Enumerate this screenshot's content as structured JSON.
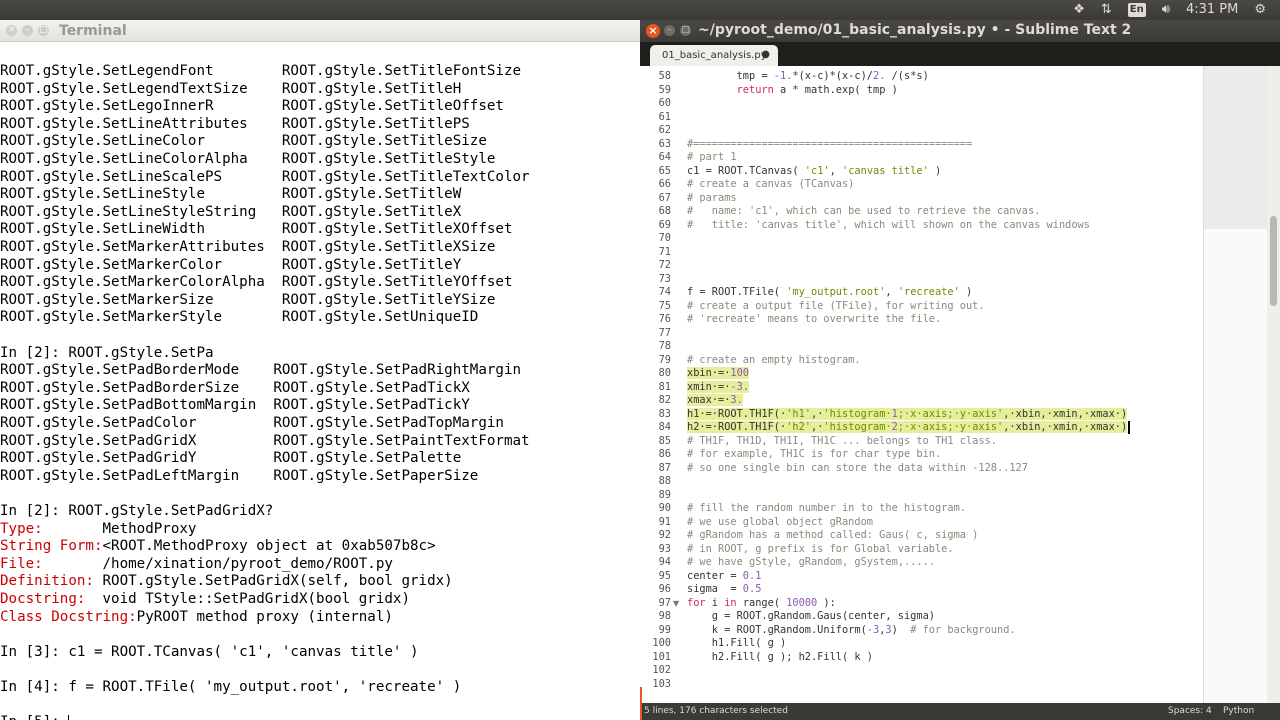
{
  "topbar": {
    "clock": "4:31 PM",
    "keyboard": "En",
    "icons": [
      "dropbox-icon",
      "network-icon",
      "keyboard-icon",
      "volume-icon",
      "clock",
      "gear-icon"
    ]
  },
  "terminal": {
    "title": "Terminal",
    "lines": [
      {
        "t": "ROOT.gStyle.SetLegendFont        ROOT.gStyle.SetTitleFontSize",
        "c": ""
      },
      {
        "t": "ROOT.gStyle.SetLegendTextSize    ROOT.gStyle.SetTitleH",
        "c": ""
      },
      {
        "t": "ROOT.gStyle.SetLegoInnerR        ROOT.gStyle.SetTitleOffset",
        "c": ""
      },
      {
        "t": "ROOT.gStyle.SetLineAttributes    ROOT.gStyle.SetTitlePS",
        "c": ""
      },
      {
        "t": "ROOT.gStyle.SetLineColor         ROOT.gStyle.SetTitleSize",
        "c": ""
      },
      {
        "t": "ROOT.gStyle.SetLineColorAlpha    ROOT.gStyle.SetTitleStyle",
        "c": ""
      },
      {
        "t": "ROOT.gStyle.SetLineScalePS       ROOT.gStyle.SetTitleTextColor",
        "c": ""
      },
      {
        "t": "ROOT.gStyle.SetLineStyle         ROOT.gStyle.SetTitleW",
        "c": ""
      },
      {
        "t": "ROOT.gStyle.SetLineStyleString   ROOT.gStyle.SetTitleX",
        "c": ""
      },
      {
        "t": "ROOT.gStyle.SetLineWidth         ROOT.gStyle.SetTitleXOffset",
        "c": ""
      },
      {
        "t": "ROOT.gStyle.SetMarkerAttributes  ROOT.gStyle.SetTitleXSize",
        "c": ""
      },
      {
        "t": "ROOT.gStyle.SetMarkerColor       ROOT.gStyle.SetTitleY",
        "c": ""
      },
      {
        "t": "ROOT.gStyle.SetMarkerColorAlpha  ROOT.gStyle.SetTitleYOffset",
        "c": ""
      },
      {
        "t": "ROOT.gStyle.SetMarkerSize        ROOT.gStyle.SetTitleYSize",
        "c": ""
      },
      {
        "t": "ROOT.gStyle.SetMarkerStyle       ROOT.gStyle.SetUniqueID",
        "c": ""
      },
      {
        "t": "",
        "c": ""
      },
      {
        "t": "In [2]: ROOT.gStyle.SetPa",
        "c": ""
      },
      {
        "t": "ROOT.gStyle.SetPadBorderMode    ROOT.gStyle.SetPadRightMargin",
        "c": ""
      },
      {
        "t": "ROOT.gStyle.SetPadBorderSize    ROOT.gStyle.SetPadTickX",
        "c": ""
      },
      {
        "t": "ROOT.gStyle.SetPadBottomMargin  ROOT.gStyle.SetPadTickY",
        "c": ""
      },
      {
        "t": "ROOT.gStyle.SetPadColor         ROOT.gStyle.SetPadTopMargin",
        "c": ""
      },
      {
        "t": "ROOT.gStyle.SetPadGridX         ROOT.gStyle.SetPaintTextFormat",
        "c": ""
      },
      {
        "t": "ROOT.gStyle.SetPadGridY         ROOT.gStyle.SetPalette",
        "c": ""
      },
      {
        "t": "ROOT.gStyle.SetPadLeftMargin    ROOT.gStyle.SetPaperSize",
        "c": ""
      },
      {
        "t": "",
        "c": ""
      },
      {
        "t": "In [2]: ROOT.gStyle.SetPadGridX?",
        "c": ""
      },
      {
        "k": "Type:",
        "t": "       MethodProxy",
        "c": "red"
      },
      {
        "k": "String Form:",
        "t": "<ROOT.MethodProxy object at 0xab507b8c>",
        "c": "red"
      },
      {
        "k": "File:",
        "t": "       /home/xination/pyroot_demo/ROOT.py",
        "c": "red"
      },
      {
        "k": "Definition:",
        "t": " ROOT.gStyle.SetPadGridX(self, bool gridx)",
        "c": "red"
      },
      {
        "k": "Docstring:",
        "t": "  void TStyle::SetPadGridX(bool gridx)",
        "c": "red"
      },
      {
        "k": "Class Docstring:",
        "t": "PyROOT method proxy (internal)",
        "c": "red"
      },
      {
        "t": "",
        "c": ""
      },
      {
        "t": "In [3]: c1 = ROOT.TCanvas( 'c1', 'canvas title' )",
        "c": ""
      },
      {
        "t": "",
        "c": ""
      },
      {
        "t": "In [4]: f = ROOT.TFile( 'my_output.root', 'recreate' )",
        "c": ""
      },
      {
        "t": "",
        "c": ""
      },
      {
        "t": "In [5]: ",
        "c": ""
      }
    ]
  },
  "sublime": {
    "title": "~/pyroot_demo/01_basic_analysis.py • - Sublime Text 2",
    "tab": "01_basic_analysis.py",
    "status_left": "5 lines, 176 characters selected",
    "status_spaces": "Spaces: 4",
    "status_lang": "Python",
    "code": [
      {
        "n": "58",
        "t": "        tmp = -1.*(x-c)*(x-c)/2. /(s*s)"
      },
      {
        "n": "59",
        "t": "        return a * math.exp( tmp )"
      },
      {
        "n": "60",
        "t": ""
      },
      {
        "n": "61",
        "t": ""
      },
      {
        "n": "62",
        "t": ""
      },
      {
        "n": "63",
        "t": "#=============================================",
        "cls": "cm"
      },
      {
        "n": "64",
        "t": "# part 1",
        "cls": "cm"
      },
      {
        "n": "65",
        "t": "c1 = ROOT.TCanvas( 'c1', 'canvas title' )"
      },
      {
        "n": "66",
        "t": "# create a canvas (TCanvas)",
        "cls": "cm"
      },
      {
        "n": "67",
        "t": "# params",
        "cls": "cm"
      },
      {
        "n": "68",
        "t": "#   name: 'c1', which can be used to retrieve the canvas.",
        "cls": "cm"
      },
      {
        "n": "69",
        "t": "#   title: 'canvas title', which will shown on the canvas windows",
        "cls": "cm"
      },
      {
        "n": "70",
        "t": ""
      },
      {
        "n": "71",
        "t": ""
      },
      {
        "n": "72",
        "t": ""
      },
      {
        "n": "73",
        "t": ""
      },
      {
        "n": "74",
        "t": "f = ROOT.TFile( 'my_output.root', 'recreate' )"
      },
      {
        "n": "75",
        "t": "# create a output file (TFile), for writing out.",
        "cls": "cm"
      },
      {
        "n": "76",
        "t": "# 'recreate' means to overwrite the file.",
        "cls": "cm"
      },
      {
        "n": "77",
        "t": ""
      },
      {
        "n": "78",
        "t": ""
      },
      {
        "n": "79",
        "t": "# create an empty histogram.",
        "cls": "cm"
      },
      {
        "n": "80",
        "t": "xbin·=·100",
        "sel": true
      },
      {
        "n": "81",
        "t": "xmin·=·-3.",
        "sel": true
      },
      {
        "n": "82",
        "t": "xmax·=·3.",
        "sel": true
      },
      {
        "n": "83",
        "t": "h1·=·ROOT.TH1F(·'h1',·'histogram·1;·x·axis;·y·axis',·xbin,·xmin,·xmax·)",
        "sel": true
      },
      {
        "n": "84",
        "t": "h2·=·ROOT.TH1F(·'h2',·'histogram·2;·x·axis;·y·axis',·xbin,·xmin,·xmax·)",
        "sel": true
      },
      {
        "n": "85",
        "t": "# TH1F, TH1D, TH1I, TH1C ... belongs to TH1 class.",
        "cls": "cm"
      },
      {
        "n": "86",
        "t": "# for example, TH1C is for char type bin.",
        "cls": "cm"
      },
      {
        "n": "87",
        "t": "# so one single bin can store the data within -128..127",
        "cls": "cm"
      },
      {
        "n": "88",
        "t": ""
      },
      {
        "n": "89",
        "t": ""
      },
      {
        "n": "90",
        "t": "# fill the random number in to the histogram.",
        "cls": "cm"
      },
      {
        "n": "91",
        "t": "# we use global object gRandom",
        "cls": "cm"
      },
      {
        "n": "92",
        "t": "# gRandom has a method called: Gaus( c, sigma )",
        "cls": "cm"
      },
      {
        "n": "93",
        "t": "# in ROOT, g prefix is for Global variable.",
        "cls": "cm"
      },
      {
        "n": "94",
        "t": "# we have gStyle, gRandom, gSystem,.....",
        "cls": "cm"
      },
      {
        "n": "95",
        "t": "center = 0.1"
      },
      {
        "n": "96",
        "t": "sigma  = 0.5"
      },
      {
        "n": "97",
        "t": "for i in range( 10000 ):",
        "fold": true
      },
      {
        "n": "98",
        "t": "    g = ROOT.gRandom.Gaus(center, sigma)"
      },
      {
        "n": "99",
        "t": "    k = ROOT.gRandom.Uniform(-3,3)  # for background."
      },
      {
        "n": "100",
        "t": "    h1.Fill( g )"
      },
      {
        "n": "101",
        "t": "    h2.Fill( g ); h2.Fill( k )"
      },
      {
        "n": "102",
        "t": ""
      },
      {
        "n": "103",
        "t": ""
      }
    ]
  }
}
